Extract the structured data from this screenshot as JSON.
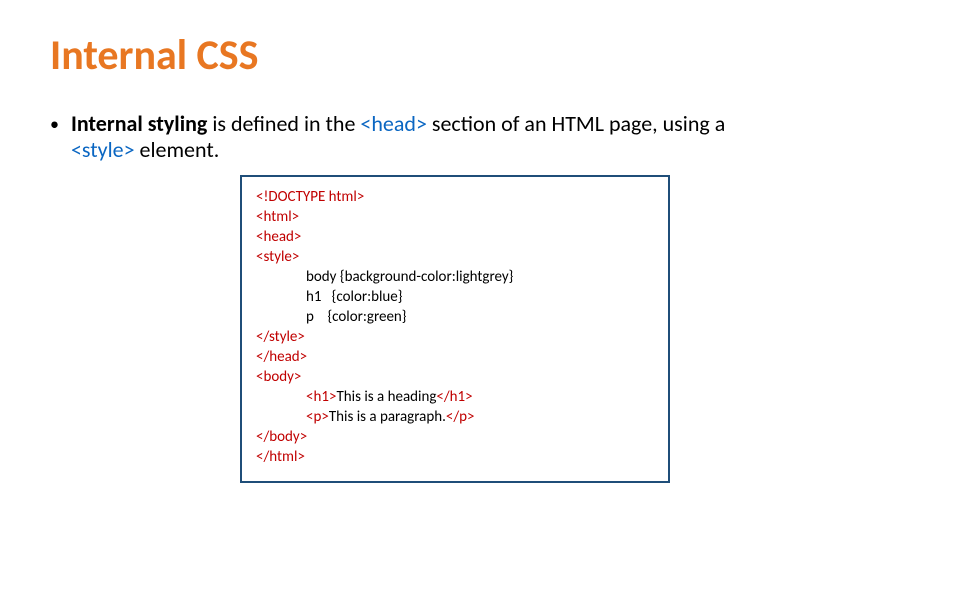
{
  "title": "Internal CSS",
  "bullet": {
    "part1_bold": "Internal styling",
    "part2": " is defined in the ",
    "tag1": "<head>",
    "part3": " section of an HTML page, using a ",
    "tag2": "<style>",
    "part4": " element."
  },
  "code": {
    "l1": "<!DOCTYPE html>",
    "l2": "<html>",
    "l3": "<head>",
    "l4": "<style>",
    "l5": "body {background-color:lightgrey}",
    "l6": "h1   {color:blue}",
    "l7": "p    {color:green}",
    "l8": "</style>",
    "l9": "</head>",
    "l10": "<body>",
    "l11a": "<h1>",
    "l11b": "This is a heading",
    "l11c": "</h1>",
    "l12a": "<p>",
    "l12b": "This is a paragraph.",
    "l12c": "</p>",
    "l13": "</body>",
    "l14": "</html>"
  }
}
